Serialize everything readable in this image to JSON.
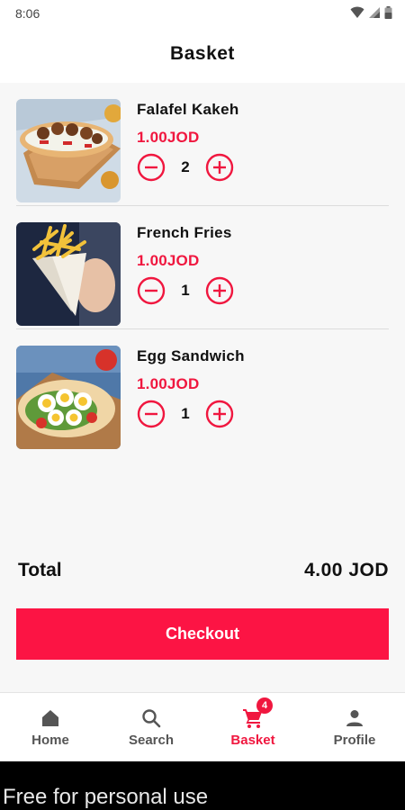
{
  "status_bar": {
    "time": "8:06",
    "icons": [
      "wifi-icon",
      "signal-icon",
      "battery-icon"
    ]
  },
  "header": {
    "title": "Basket"
  },
  "basket": {
    "items": [
      {
        "name": "Falafel Kakeh",
        "price": "1.00JOD",
        "quantity": "2",
        "image": "falafel-sandwich"
      },
      {
        "name": "French Fries",
        "price": "1.00JOD",
        "quantity": "1",
        "image": "french-fries-cone"
      },
      {
        "name": "Egg Sandwich",
        "price": "1.00JOD",
        "quantity": "1",
        "image": "egg-sandwich"
      }
    ]
  },
  "summary": {
    "total_label": "Total",
    "total_value": "4.00 JOD"
  },
  "checkout": {
    "label": "Checkout"
  },
  "nav": {
    "items": [
      {
        "label": "Home",
        "icon": "home-icon",
        "active": false
      },
      {
        "label": "Search",
        "icon": "search-icon",
        "active": false
      },
      {
        "label": "Basket",
        "icon": "cart-icon",
        "active": true,
        "badge": "4"
      },
      {
        "label": "Profile",
        "icon": "person-icon",
        "active": false
      }
    ]
  },
  "watermark": {
    "text": "Free for personal use"
  },
  "colors": {
    "accent": "#f0173f",
    "checkout": "#fc1444",
    "background": "#f7f7f7"
  }
}
